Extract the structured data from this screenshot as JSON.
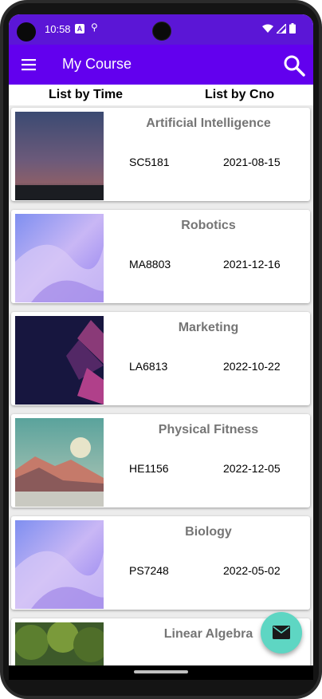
{
  "status_bar": {
    "time": "10:58",
    "a_icon": "A"
  },
  "app_bar": {
    "title": "My Course",
    "menu_icon": "hamburger-menu-icon",
    "search_icon": "search-icon"
  },
  "sort_tabs": {
    "by_time": "List by Time",
    "by_cno": "List by Cno"
  },
  "courses": [
    {
      "name": "Artificial Intelligence",
      "cno": "SC5181",
      "date": "2021-08-15"
    },
    {
      "name": "Robotics",
      "cno": "MA8803",
      "date": "2021-12-16"
    },
    {
      "name": "Marketing",
      "cno": "LA6813",
      "date": "2022-10-22"
    },
    {
      "name": "Physical Fitness",
      "cno": "HE1156",
      "date": "2022-12-05"
    },
    {
      "name": "Biology",
      "cno": "PS7248",
      "date": "2022-05-02"
    },
    {
      "name": "Linear Algebra",
      "cno": "",
      "date": ""
    }
  ],
  "fab": {
    "icon": "email-icon"
  },
  "colors": {
    "app_bar": "#6200ee",
    "status_bar": "#5b16d6",
    "fab": "#5ed6c3",
    "title_gray": "#757575"
  }
}
